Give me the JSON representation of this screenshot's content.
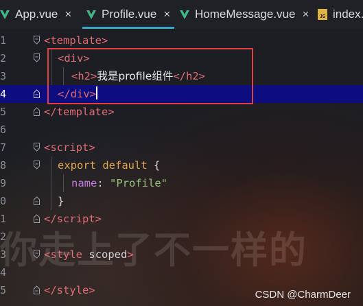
{
  "tabs": [
    {
      "label": "App.vue",
      "icon": "vue-icon",
      "active": false,
      "closable": true
    },
    {
      "label": "Profile.vue",
      "icon": "vue-icon",
      "active": true,
      "closable": true
    },
    {
      "label": "HomeMessage.vue",
      "icon": "vue-icon",
      "active": false,
      "closable": true
    },
    {
      "label": "index.",
      "icon": "js-file-icon",
      "active": false,
      "closable": false
    }
  ],
  "js_icon_text": "JS",
  "close_glyph": "×",
  "line_numbers": [
    "1",
    "2",
    "3",
    "4",
    "5",
    "6",
    "7",
    "8",
    "9",
    "0",
    "1",
    "2",
    "3",
    "4",
    "5"
  ],
  "code": {
    "l1_tag": "template",
    "l2_tag": "div",
    "l3_tag": "h2",
    "l3_text": "我是profile组件",
    "l4_tag": "div",
    "l5_tag": "template",
    "l7_tag": "script",
    "l8_kw1": "export",
    "l8_kw2": "default",
    "l8_brace": "{",
    "l9_key": "name",
    "l9_colon": ":",
    "l9_value": "\"Profile\"",
    "l10_brace": "}",
    "l11_tag": "script",
    "l13_tag": "style",
    "l13_attr": "scoped",
    "l15_tag": "style"
  },
  "wallpaper_text": "你走上了不一样的",
  "watermark": "CSDN @CharmDeer",
  "colors": {
    "tab_active_underline": "#3aa6c9",
    "current_line": "#0d0d80",
    "highlight_box": "#e04040",
    "vue_icon": "#41b883"
  }
}
